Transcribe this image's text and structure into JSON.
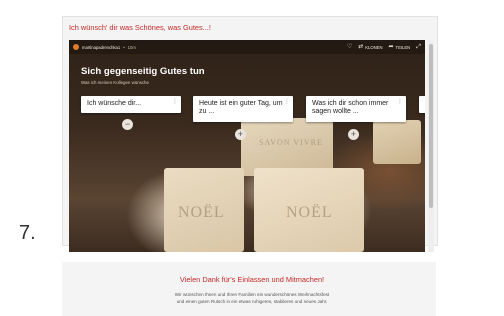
{
  "page": {
    "heading": "Ich wünsch' dir was Schönes, was Gutes...!",
    "step_number": "7.",
    "thanks": "Vielen Dank für's Einlassen und Mitmachen!",
    "wish_line_1": "Wir wünschen Ihnen und Ihren Familien ein wunderschönes Weihnachtsfest",
    "wish_line_2": "und einen guten Rutsch in ein etwas ruhigeres, stabileres und neues Jahr."
  },
  "board": {
    "author": "martinapadrenchka1",
    "separator": "•",
    "time": "10m",
    "title": "Sich gegenseitig Gutes tun",
    "subtitle": "Was ich meinen Kollegen wünsche",
    "toolbar": {
      "like_icon": "heart-icon",
      "remake_label": "KLONEN",
      "share_label": "TEILEN",
      "fullscreen_icon": "fullscreen-icon"
    },
    "columns": [
      {
        "title": "Ich wünsche dir..."
      },
      {
        "title": "Heute ist ein guter Tag, um zu ..."
      },
      {
        "title": "Was ich dir schon immer sagen wollte ..."
      }
    ],
    "soap_stamps": [
      "NOËL",
      "NOËL",
      "SAVON VIVRE"
    ]
  },
  "colors": {
    "heading_red": "#c62828",
    "avatar_orange": "#e07b2a"
  }
}
